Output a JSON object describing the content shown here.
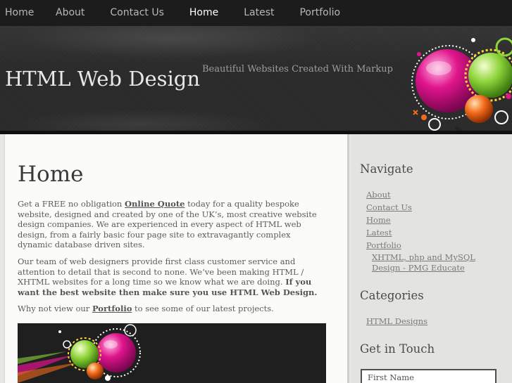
{
  "nav": {
    "items": [
      {
        "label": "Home",
        "active": false
      },
      {
        "label": "About",
        "active": false
      },
      {
        "label": "Contact Us",
        "active": false
      },
      {
        "label": "Home",
        "active": true
      },
      {
        "label": "Latest",
        "active": false
      },
      {
        "label": "Portfolio",
        "active": false
      }
    ]
  },
  "header": {
    "site_title": "HTML Web Design",
    "tagline": "Beautiful Websites Created With Markup"
  },
  "main": {
    "title": "Home",
    "p1": {
      "before": "Get a FREE no obligation ",
      "link": "Online Quote",
      "after": " today for a quality bespoke website, designed and created by one of the UK’s, most creative website design companies. We are experienced in every aspect of HTML web design, from a fairly basic four page site to extravagantly complex dynamic database driven sites."
    },
    "p2": {
      "text": "Our team of web designers provide first class customer service and attention to detail that is second to none. We’ve been making HTML / XHTML websites for a long time so we know what we are doing. ",
      "bold": "If you want the best website then make sure you use HTML Web Design."
    },
    "p3": {
      "before": "Why not view our ",
      "link": "Portfolio",
      "after": " to see some of our latest projects."
    }
  },
  "sidebar": {
    "navigate_heading": "Navigate",
    "navigate_links": [
      "About",
      "Contact Us",
      "Home",
      "Latest",
      "Portfolio"
    ],
    "navigate_sub": "XHTML, php and MySQL Design - PMG Educate",
    "categories_heading": "Categories",
    "categories_links": [
      "HTML Designs"
    ],
    "get_in_touch_heading": "Get in Touch",
    "first_name_placeholder": "First Name"
  },
  "colors": {
    "nav_bg": "#1c1c1c",
    "header_bg": "#2c2c2c",
    "content_bg": "#fbfbfa",
    "sidebar_bg": "#e3e3e1",
    "accent_pink": "#e0148c",
    "accent_green": "#8fd43a",
    "accent_orange": "#f26a1b"
  }
}
